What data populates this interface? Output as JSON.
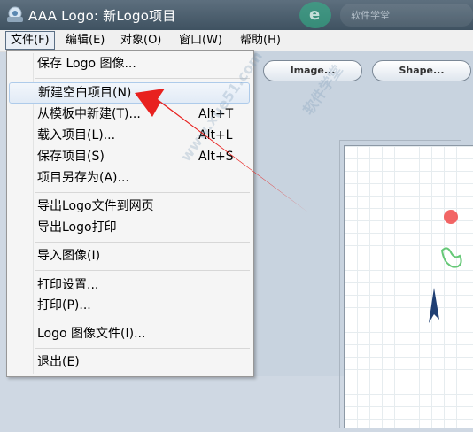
{
  "window": {
    "title": "AAA Logo: 新Logo项目",
    "background_text": "软件学堂"
  },
  "menubar": {
    "items": [
      {
        "label": "文件(F)",
        "active": true
      },
      {
        "label": "编辑(E)"
      },
      {
        "label": "对象(O)"
      },
      {
        "label": "窗口(W)"
      },
      {
        "label": "帮助(H)"
      }
    ]
  },
  "toolbar": {
    "image_label": "Image...",
    "shape_label": "Shape..."
  },
  "file_menu": {
    "items": [
      {
        "label": "保存 Logo 图像...",
        "shortcut": ""
      },
      {
        "label": "新建空白项目(N)",
        "shortcut": "",
        "highlighted": true
      },
      {
        "label": "从模板中新建(T)...",
        "shortcut": "Alt+T"
      },
      {
        "label": "载入项目(L)...",
        "shortcut": "Alt+L"
      },
      {
        "label": "保存项目(S)",
        "shortcut": "Alt+S"
      },
      {
        "label": "项目另存为(A)...",
        "shortcut": ""
      },
      {
        "label": "导出Logo文件到网页",
        "shortcut": ""
      },
      {
        "label": "导出Logo打印",
        "shortcut": ""
      },
      {
        "label": "导入图像(I)",
        "shortcut": ""
      },
      {
        "label": "打印设置...",
        "shortcut": ""
      },
      {
        "label": "打印(P)...",
        "shortcut": ""
      },
      {
        "label": "Logo 图像文件(I)...",
        "shortcut": ""
      },
      {
        "label": "退出(E)",
        "shortcut": ""
      }
    ]
  },
  "watermark": {
    "text_1": "软件学堂",
    "text_2": "www.xue51.com"
  },
  "colors": {
    "arrow": "#e8211f",
    "highlight_border": "#aecbea",
    "titlebar": "#4d5f6e"
  }
}
